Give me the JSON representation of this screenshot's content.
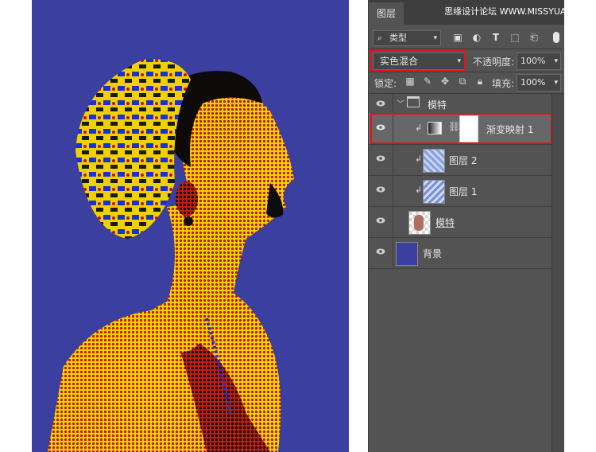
{
  "panel": {
    "tab": "图层",
    "watermark": "思缘设计论坛 WWW.MISSYUAN.COM",
    "filter": {
      "label": "类型",
      "search_icon": "search-icon"
    },
    "filter_icons": [
      "image-filter-icon",
      "adjustment-filter-icon",
      "type-filter-icon",
      "shape-filter-icon",
      "smart-object-filter-icon"
    ],
    "blend_mode": "实色混合",
    "opacity_label": "不透明度:",
    "opacity_value": "100%",
    "lock_label": "锁定:",
    "fill_label": "填充:",
    "fill_value": "100%",
    "lock_icons": [
      "lock-transparent-icon",
      "lock-paint-icon",
      "lock-move-icon",
      "lock-artboard-icon",
      "lock-all-icon"
    ]
  },
  "layers": [
    {
      "name": "模特",
      "kind": "group"
    },
    {
      "name": "渐变映射 1",
      "kind": "adjustment",
      "selected": true
    },
    {
      "name": "图层 2",
      "kind": "layer"
    },
    {
      "name": "图层 1",
      "kind": "layer"
    },
    {
      "name": "模特",
      "kind": "layer"
    },
    {
      "name": "背景",
      "kind": "background"
    }
  ],
  "colors": {
    "canvas_bg": "#3a3fa0",
    "highlight": "#e3121d",
    "panel_bg": "#535353"
  }
}
